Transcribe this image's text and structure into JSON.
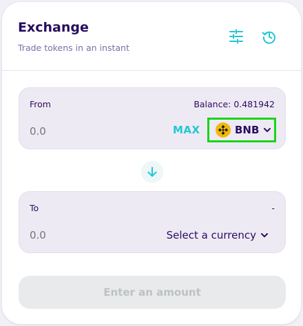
{
  "header": {
    "title": "Exchange",
    "subtitle": "Trade tokens in an instant"
  },
  "from": {
    "label": "From",
    "balance": "Balance: 0.481942",
    "amount_placeholder": "0.0",
    "max_label": "MAX",
    "currency": "BNB"
  },
  "to": {
    "label": "To",
    "balance": "-",
    "amount_placeholder": "0.0",
    "select_label": "Select a currency"
  },
  "submit": {
    "label": "Enter an amount"
  },
  "colors": {
    "accent": "#1fc7d4",
    "text": "#280d5f",
    "subtle": "#7a6eaa",
    "highlight": "#17d617",
    "bnb": "#f0b90b"
  }
}
